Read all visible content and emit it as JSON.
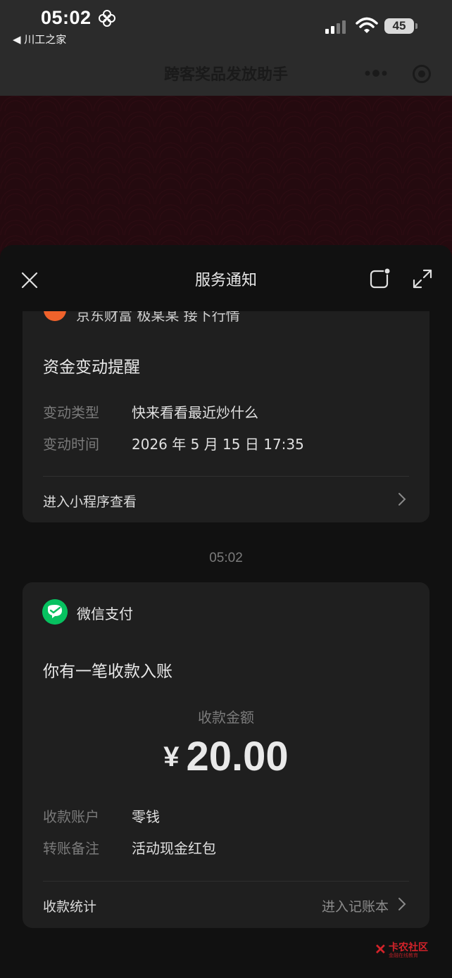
{
  "status_bar": {
    "time": "05:02",
    "back_app": "◀ 川工之家",
    "battery": "45"
  },
  "header": {
    "title": "跨客奖品发放助手"
  },
  "sheet": {
    "title": "服务通知"
  },
  "notice_card": {
    "partial_title": "京东财富 极某某 接下行情",
    "heading": "资金变动提醒",
    "rows": [
      {
        "label": "变动类型",
        "value": "快来看看最近炒什么"
      },
      {
        "label": "变动时间",
        "value": "2026 年 5 月 15 日 17:35"
      }
    ],
    "link": "进入小程序查看"
  },
  "timestamp": "05:02",
  "payment_card": {
    "sender": "微信支付",
    "heading": "你有一笔收款入账",
    "amount_label": "收款金额",
    "currency": "¥",
    "amount": "20.00",
    "rows": [
      {
        "label": "收款账户",
        "value": "零钱"
      },
      {
        "label": "转账备注",
        "value": "活动现金红包"
      }
    ],
    "footer_left": "收款统计",
    "footer_right": "进入记账本"
  },
  "watermark": {
    "text": "卡农社区",
    "sub": "金融在线教育"
  },
  "colors": {
    "wechat_green": "#07c160",
    "background": "#111111",
    "card": "#1f1f1f",
    "header": "#2b2b2b",
    "pattern": "#240a0f"
  }
}
